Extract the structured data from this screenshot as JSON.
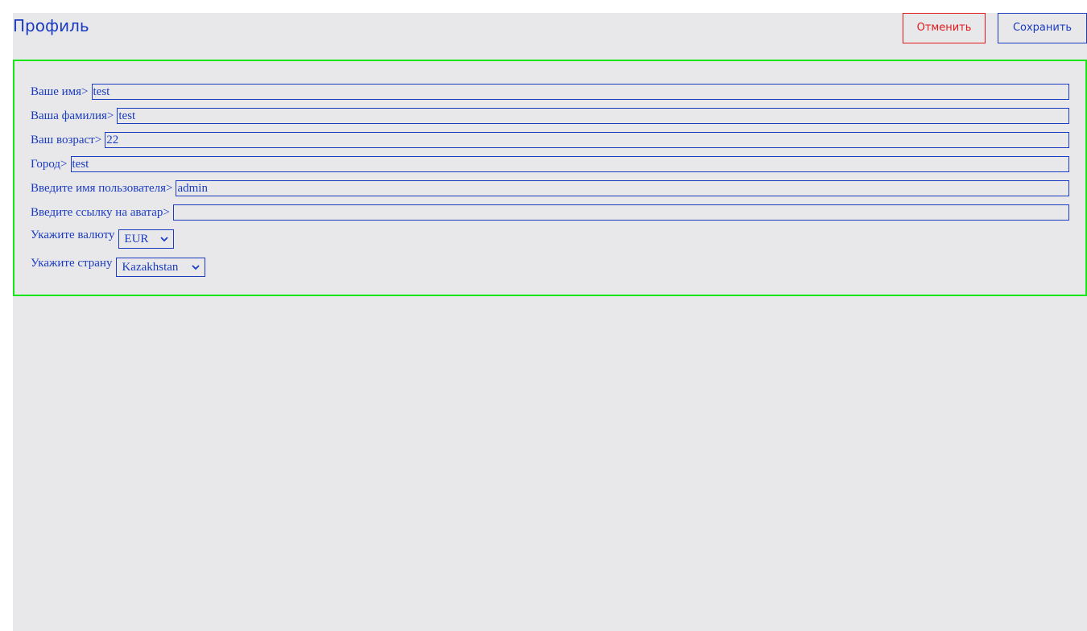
{
  "header": {
    "title": "Профиль",
    "cancel_label": "Отменить",
    "save_label": "Сохранить"
  },
  "form": {
    "first_name": {
      "label": "Ваше имя>",
      "value": "test"
    },
    "last_name": {
      "label": "Ваша фамилия>",
      "value": "test"
    },
    "age": {
      "label": "Ваш возраст>",
      "value": "22"
    },
    "city": {
      "label": "Город>",
      "value": "test"
    },
    "username": {
      "label": "Введите имя пользователя>",
      "value": "admin"
    },
    "avatar": {
      "label": "Введите ссылку на аватар>",
      "value": ""
    },
    "currency": {
      "label": "Укажите валюту",
      "value": "EUR"
    },
    "country": {
      "label": "Укажите страну",
      "value": "Kazakhstan"
    }
  },
  "colors": {
    "text": "#1a3bbf",
    "cancel": "#e01a1a",
    "card_border": "#19e619",
    "background": "#e8e8eb"
  },
  "icons": {
    "select_arrow": "chevron-down-icon"
  }
}
